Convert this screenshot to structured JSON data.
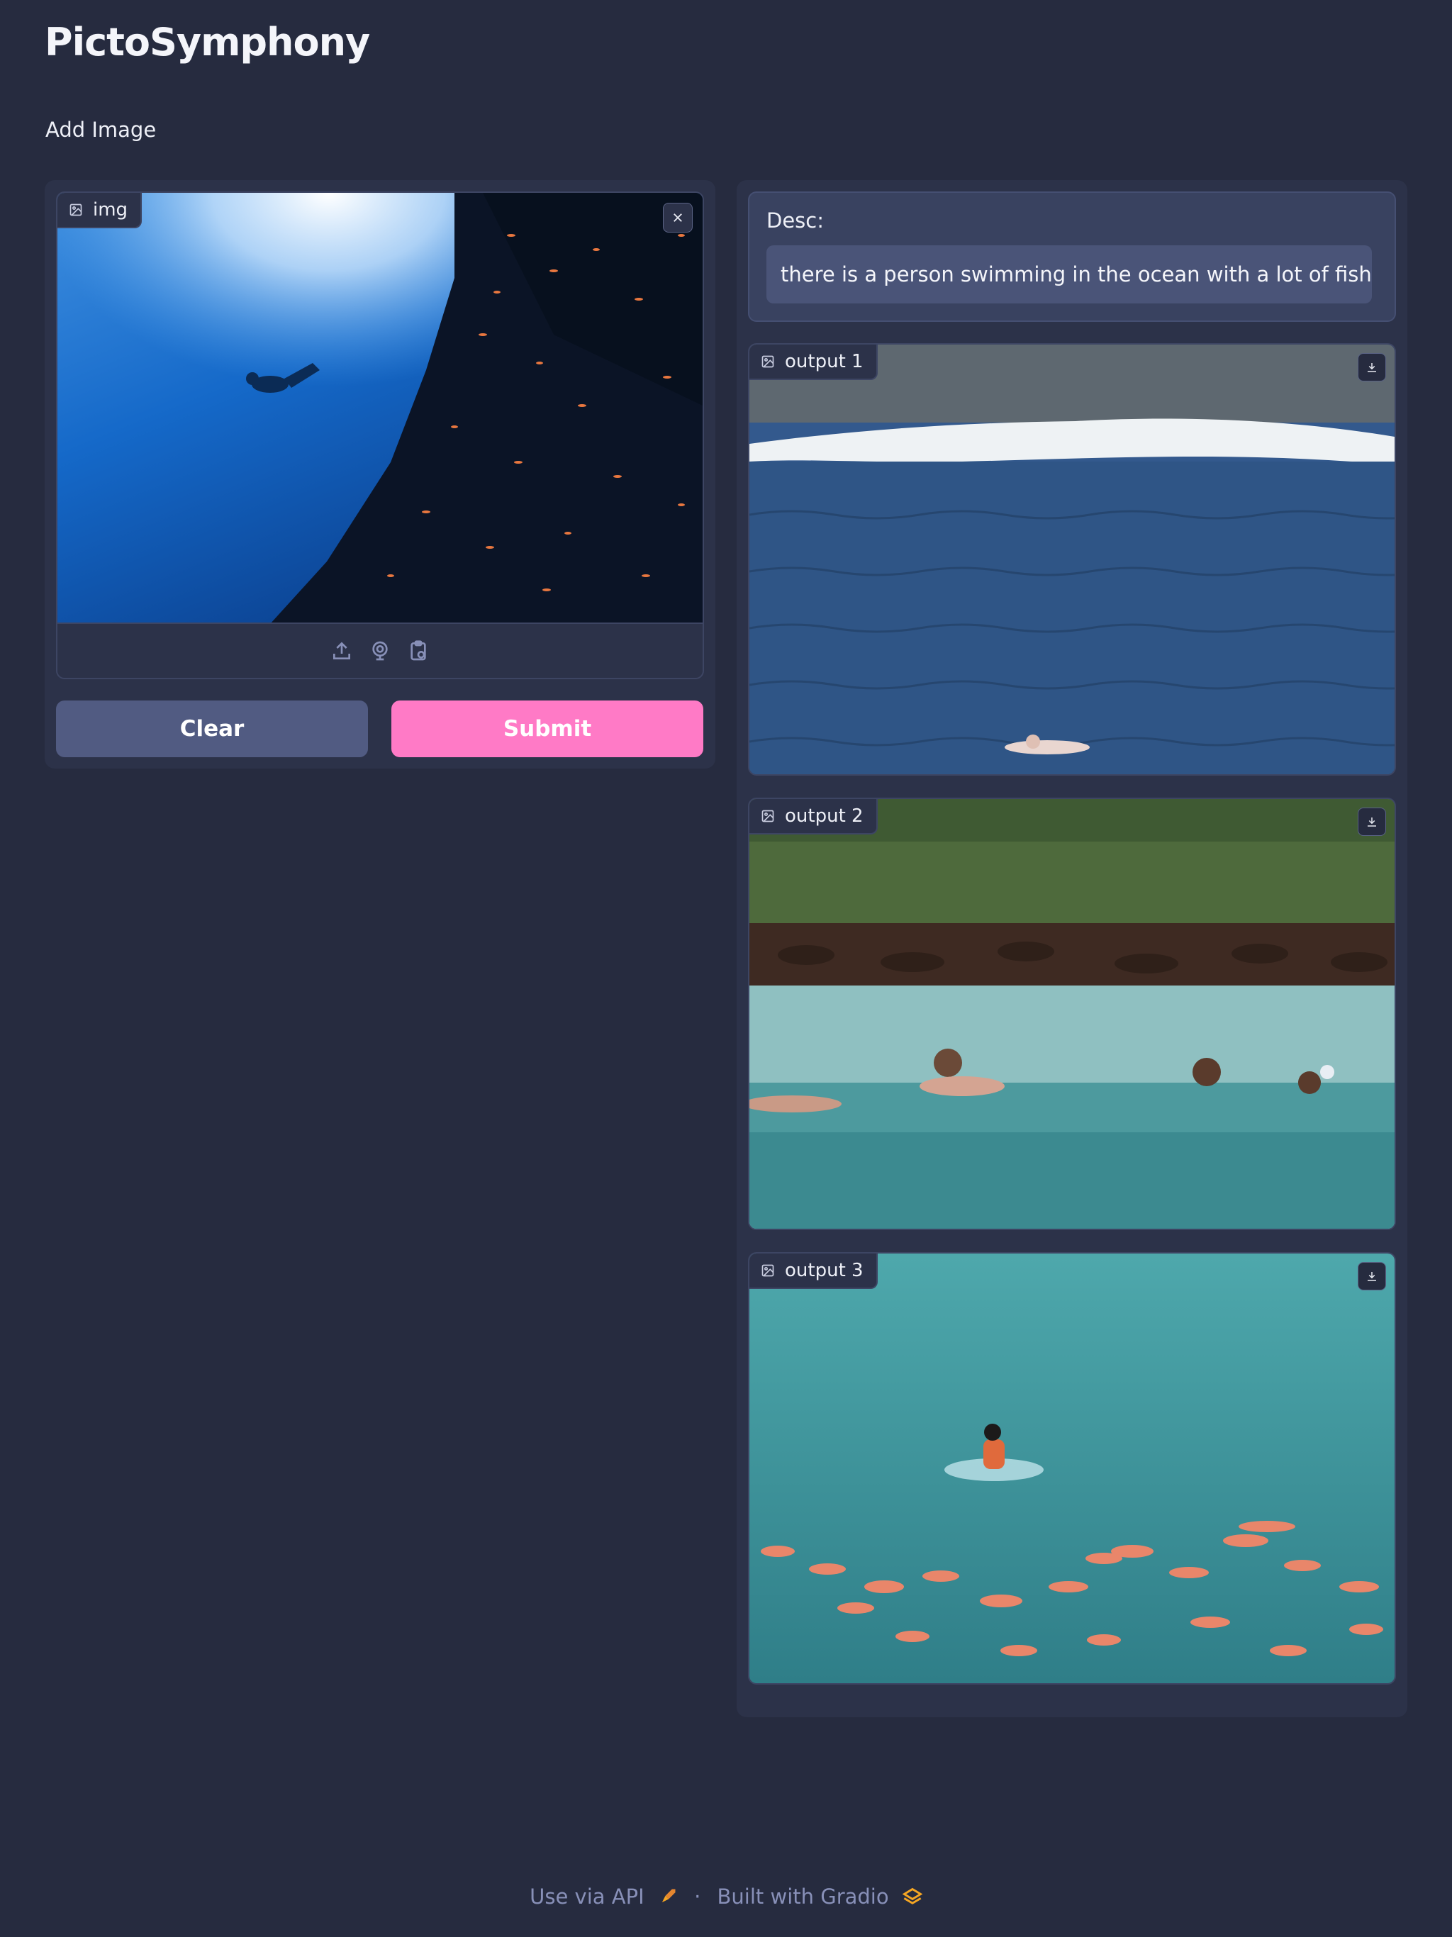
{
  "app": {
    "title": "PictoSymphony"
  },
  "input": {
    "section_label": "Add Image",
    "image_label": "img",
    "source_icons": [
      "upload-icon",
      "webcam-icon",
      "clipboard-icon"
    ],
    "close_icon": "close-icon",
    "clear_label": "Clear",
    "submit_label": "Submit"
  },
  "description": {
    "label": "Desc:",
    "value": "there is a person swimming in the ocean with a lot of fish"
  },
  "outputs": [
    {
      "label": "output 1",
      "icon": "image-icon",
      "download_icon": "download-icon"
    },
    {
      "label": "output 2",
      "icon": "image-icon",
      "download_icon": "download-icon"
    },
    {
      "label": "output 3",
      "icon": "image-icon",
      "download_icon": "download-icon"
    }
  ],
  "footer": {
    "api_label": "Use via API",
    "separator": "·",
    "built_label": "Built with Gradio"
  },
  "colors": {
    "background": "#262b3f",
    "panel": "#2c3249",
    "clear_button": "#515b82",
    "submit_button": "#ff7ac6",
    "footer_text": "#8890b8"
  }
}
